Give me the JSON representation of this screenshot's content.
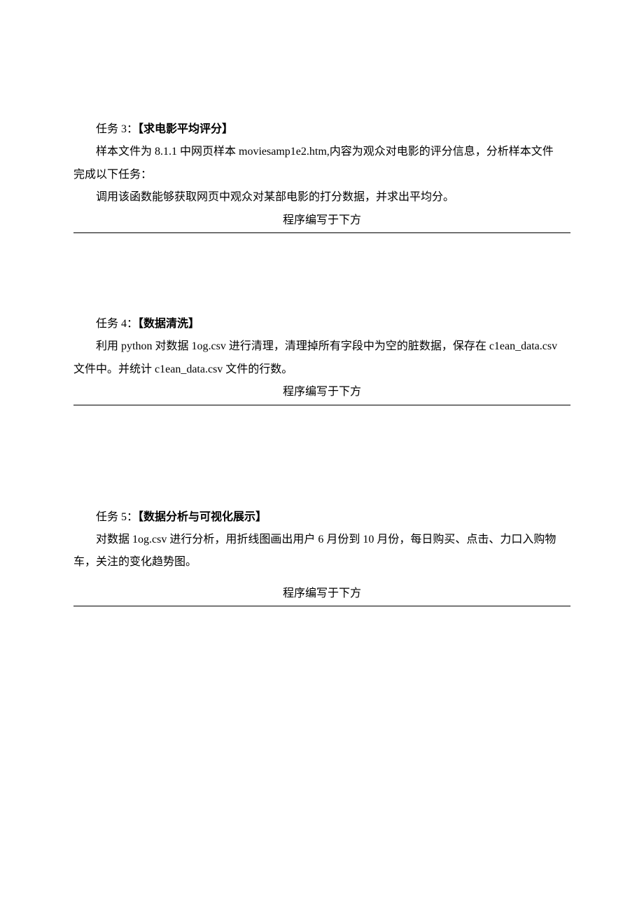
{
  "task3": {
    "title_prefix": "任务 3：",
    "title_bracket": "【求电影平均评分】",
    "desc_line1_a": "样本文件为 8.1.1 中网页样本 ",
    "desc_line1_latin": "moviesamp1e2.htm,",
    "desc_line1_b": "内容为观众对电影的评分信息，分析样本文件",
    "desc_line2": "完成以下任务：",
    "desc_line3": "调用该函数能够获取网页中观众对某部电影的打分数据，并求出平均分。",
    "code_label": "程序编写于下方"
  },
  "task4": {
    "title_prefix": "任务 4：",
    "title_bracket": "【数据清洗】",
    "desc_line1_a": "利用 ",
    "desc_line1_latin1": "python",
    "desc_line1_b": " 对数据 ",
    "desc_line1_latin2": "1og.csv",
    "desc_line1_c": " 进行清理，清理掉所有字段中为空的脏数据，保存在 ",
    "desc_line1_latin3": "c1ean_data.csv",
    "desc_line2_a": "文件中。并统计 ",
    "desc_line2_latin": "c1ean_data.csv",
    "desc_line2_b": " 文件的行数。",
    "code_label": "程序编写于下方"
  },
  "task5": {
    "title_prefix": "任务 5：",
    "title_bracket": "【数据分析与可视化展示】",
    "desc_line1_a": "对数据 ",
    "desc_line1_latin": "1og.csv",
    "desc_line1_b": " 进行分析，用折线图画出用户 6 月份到 10 月份，每日购买、点击、力口入购物",
    "desc_line2": "车，关注的变化趋势图。",
    "code_label": "程序编写于下方"
  }
}
